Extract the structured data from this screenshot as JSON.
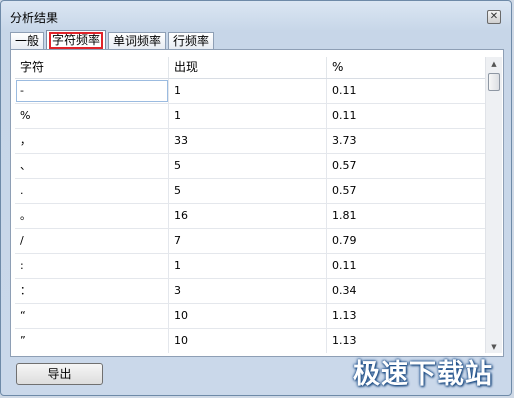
{
  "window": {
    "title": "分析结果"
  },
  "tabs": [
    {
      "label": "一般",
      "active": false
    },
    {
      "label": "字符频率",
      "active": true
    },
    {
      "label": "单词频率",
      "active": false
    },
    {
      "label": "行频率",
      "active": false
    }
  ],
  "grid": {
    "columns": [
      "字符",
      "出现",
      "%"
    ],
    "rows": [
      [
        "-",
        "1",
        "0.11"
      ],
      [
        "%",
        "1",
        "0.11"
      ],
      [
        "，",
        "33",
        "3.73"
      ],
      [
        "、",
        "5",
        "0.57"
      ],
      [
        ".",
        "5",
        "0.57"
      ],
      [
        "。",
        "16",
        "1.81"
      ],
      [
        "/",
        "7",
        "0.79"
      ],
      [
        ":",
        "1",
        "0.11"
      ],
      [
        "：",
        "3",
        "0.34"
      ],
      [
        "“",
        "10",
        "1.13"
      ],
      [
        "”",
        "10",
        "1.13"
      ]
    ]
  },
  "buttons": {
    "export_label": "导出"
  },
  "watermark": "极速下载站",
  "colors": {
    "active_tab_highlight": "#e0242a",
    "window_frame": "#c7d6e8"
  }
}
